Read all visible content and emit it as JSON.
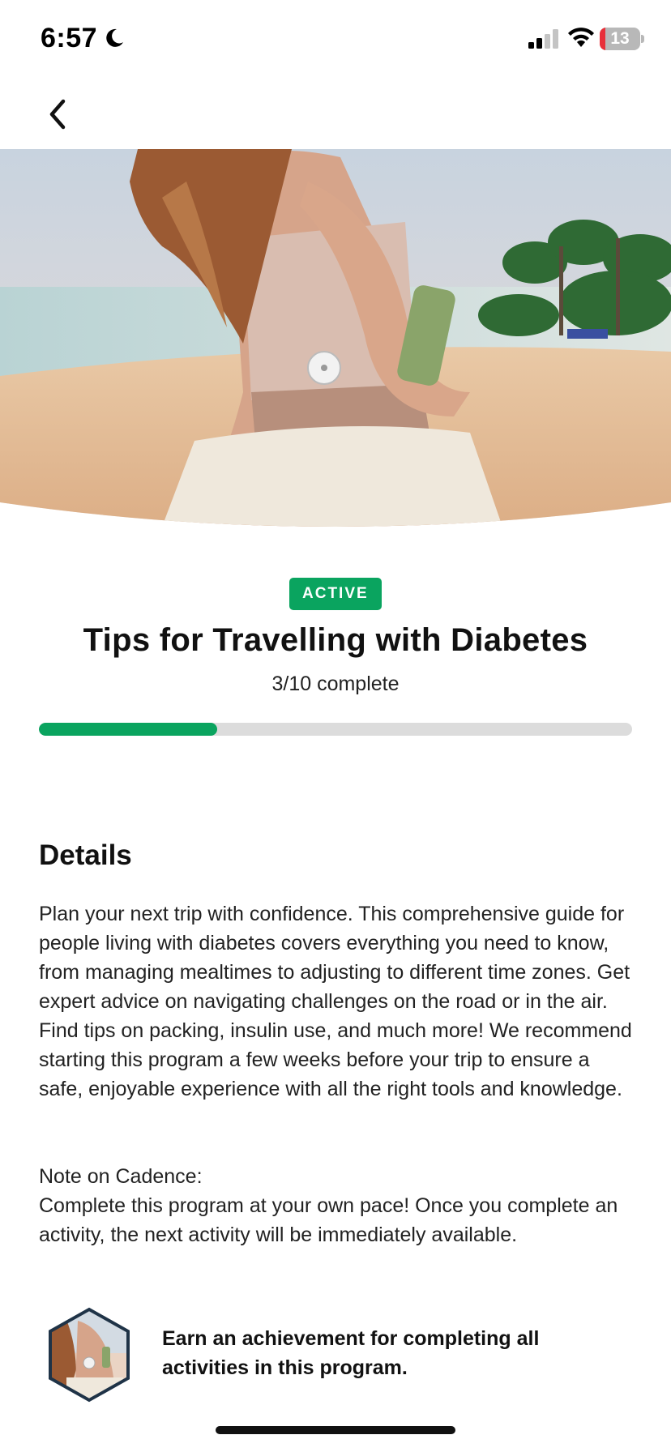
{
  "status_bar": {
    "time": "6:57",
    "battery_level": "13",
    "icons": [
      "moon-icon",
      "cellular-signal-icon",
      "wifi-icon",
      "battery-icon"
    ]
  },
  "nav": {
    "back_icon": "chevron-left-icon"
  },
  "program": {
    "status_badge": "ACTIVE",
    "title": "Tips for Travelling with Diabetes",
    "progress_text": "3/10 complete",
    "progress_fraction": 0.3
  },
  "details": {
    "heading": "Details",
    "body": "Plan your next trip with confidence. This comprehensive guide for people living with diabetes covers everything you need to know, from managing mealtimes to adjusting to different time zones. Get expert advice on navigating challenges on the road or in the air. Find tips on packing, insulin use, and much more! We recommend starting this program a few weeks before your trip to ensure a safe, enjoyable experience with all the right tools and knowledge.",
    "note_title": "Note on Cadence:",
    "note_body": "Complete this program at your own pace! Once you complete an activity, the next activity will be immediately available."
  },
  "achievement": {
    "text": "Earn an achievement for completing all activities in this program."
  },
  "colors": {
    "accent": "#0aa45f",
    "progress_track": "#dcdcdc",
    "badge_border": "#1f3347",
    "battery_low": "#e8303a"
  }
}
